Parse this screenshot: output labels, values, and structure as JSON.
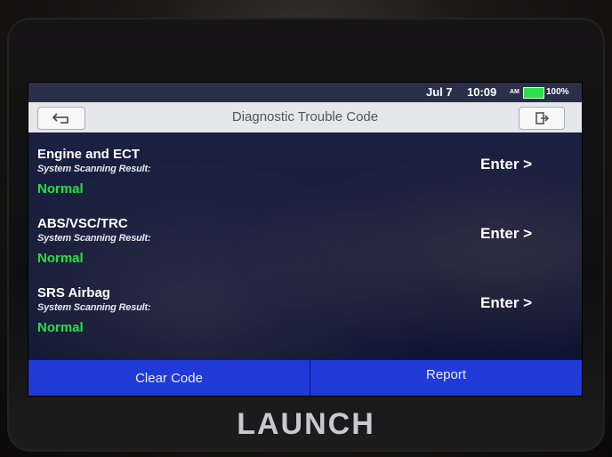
{
  "status_bar": {
    "date": "Jul 7",
    "time": "10:09",
    "ampm": "AM",
    "battery": "100%",
    "battery_color": "#2ee04a"
  },
  "header": {
    "title": "Diagnostic Trouble Code",
    "back_icon": "back-arrow-icon",
    "exit_icon": "exit-icon"
  },
  "systems": [
    {
      "name": "Engine and ECT",
      "subtitle": "System Scanning Result:",
      "status": "Normal",
      "action": "Enter >"
    },
    {
      "name": "ABS/VSC/TRC",
      "subtitle": "System Scanning Result:",
      "status": "Normal",
      "action": "Enter >"
    },
    {
      "name": "SRS Airbag",
      "subtitle": "System Scanning Result:",
      "status": "Normal",
      "action": "Enter >"
    }
  ],
  "footer": {
    "clear_label": "Clear Code",
    "report_label": "Report",
    "accent": "#1f3ad6"
  },
  "device": {
    "brand": "LAUNCH"
  },
  "colors": {
    "status_normal": "#25e043",
    "screen_bg": "#0d1533"
  }
}
